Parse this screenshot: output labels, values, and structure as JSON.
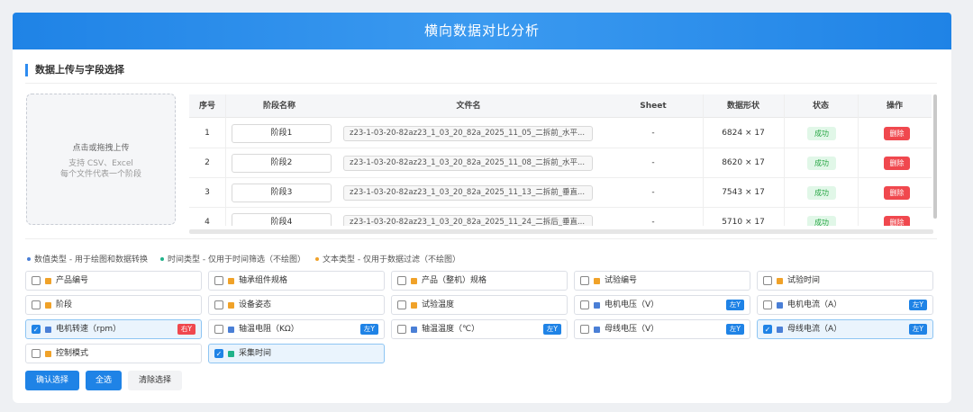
{
  "header": {
    "title": "横向数据对比分析"
  },
  "section": {
    "title": "数据上传与字段选择"
  },
  "upload": {
    "line1": "点击或拖拽上传",
    "line2": "支持 CSV、Excel",
    "line3": "每个文件代表一个阶段"
  },
  "table": {
    "columns": [
      "序号",
      "阶段名称",
      "文件名",
      "Sheet",
      "数据形状",
      "状态",
      "操作"
    ],
    "rows": [
      {
        "index": "1",
        "stage": "阶段1",
        "file": "z23-1-03-20-82az23_1_03_20_82a_2025_11_05_二拆前_水平...",
        "sheet": "-",
        "shape": "6824 × 17",
        "status": "成功",
        "action": "删除"
      },
      {
        "index": "2",
        "stage": "阶段2",
        "file": "z23-1-03-20-82az23_1_03_20_82a_2025_11_08_二拆前_水平...",
        "sheet": "-",
        "shape": "8620 × 17",
        "status": "成功",
        "action": "删除"
      },
      {
        "index": "3",
        "stage": "阶段3",
        "file": "z23-1-03-20-82az23_1_03_20_82a_2025_11_13_二拆前_垂直...",
        "sheet": "-",
        "shape": "7543 × 17",
        "status": "成功",
        "action": "删除"
      },
      {
        "index": "4",
        "stage": "阶段4",
        "file": "z23-1-03-20-82az23_1_03_20_82a_2025_11_24_二拆后_垂直...",
        "sheet": "-",
        "shape": "5710 × 17",
        "status": "成功",
        "action": "删除"
      }
    ]
  },
  "legend": {
    "numeric": "数值类型 - 用于绘图和数据转换",
    "time": "时间类型 - 仅用于时间筛选（不绘图）",
    "text": "文本类型 - 仅用于数据过滤（不绘图）"
  },
  "colors": {
    "accent": "#1f83e6",
    "numeric": "#4a7fd6",
    "time": "#1fb38a",
    "text": "#f0a229",
    "left_axis": "#1f83e6",
    "right_axis": "#f0484e",
    "success_bg": "#e1f7e8",
    "success_text": "#28a745",
    "danger": "#f0484e"
  },
  "fields": [
    {
      "label": "产品编号",
      "type": "text",
      "checked": false,
      "axis": ""
    },
    {
      "label": "轴承组件规格",
      "type": "text",
      "checked": false,
      "axis": ""
    },
    {
      "label": "产品（整机）规格",
      "type": "text",
      "checked": false,
      "axis": ""
    },
    {
      "label": "试验编号",
      "type": "text",
      "checked": false,
      "axis": ""
    },
    {
      "label": "试验时间",
      "type": "text",
      "checked": false,
      "axis": ""
    },
    {
      "label": "阶段",
      "type": "text",
      "checked": false,
      "axis": ""
    },
    {
      "label": "设备姿态",
      "type": "text",
      "checked": false,
      "axis": ""
    },
    {
      "label": "试验温度",
      "type": "text",
      "checked": false,
      "axis": ""
    },
    {
      "label": "电机电压（V）",
      "type": "numeric",
      "checked": false,
      "axis": "左Y"
    },
    {
      "label": "电机电流（A）",
      "type": "numeric",
      "checked": false,
      "axis": "左Y"
    },
    {
      "label": "电机转速（rpm）",
      "type": "numeric",
      "checked": true,
      "axis": "右Y"
    },
    {
      "label": "轴温电阻（KΩ）",
      "type": "numeric",
      "checked": false,
      "axis": "左Y"
    },
    {
      "label": "轴温温度（℃）",
      "type": "numeric",
      "checked": false,
      "axis": "左Y"
    },
    {
      "label": "母线电压（V）",
      "type": "numeric",
      "checked": false,
      "axis": "左Y"
    },
    {
      "label": "母线电流（A）",
      "type": "numeric",
      "checked": true,
      "axis": "左Y"
    },
    {
      "label": "控制模式",
      "type": "text",
      "checked": false,
      "axis": ""
    },
    {
      "label": "采集时间",
      "type": "time",
      "checked": true,
      "axis": ""
    }
  ],
  "buttons": {
    "confirm": "确认选择",
    "select_all": "全选",
    "clear": "清除选择"
  }
}
